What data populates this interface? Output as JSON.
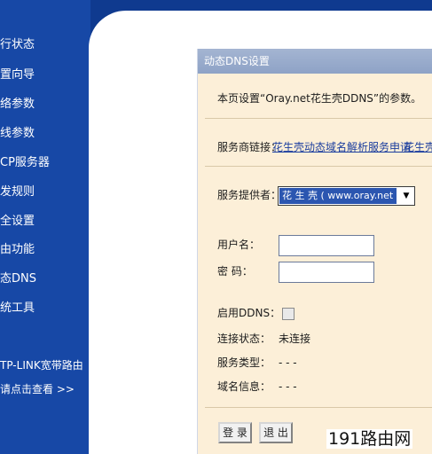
{
  "sidebar": {
    "items": [
      {
        "label": "行状态",
        "name": "sidebar-item-status"
      },
      {
        "label": "置向导",
        "name": "sidebar-item-wizard"
      },
      {
        "label": "络参数",
        "name": "sidebar-item-network"
      },
      {
        "label": "线参数",
        "name": "sidebar-item-wireless"
      },
      {
        "label": "CP服务器",
        "name": "sidebar-item-dhcp"
      },
      {
        "label": "发规则",
        "name": "sidebar-item-forwarding"
      },
      {
        "label": "全设置",
        "name": "sidebar-item-security"
      },
      {
        "label": "由功能",
        "name": "sidebar-item-routing"
      },
      {
        "label": "态DNS",
        "name": "sidebar-item-ddns"
      },
      {
        "label": "统工具",
        "name": "sidebar-item-tools"
      }
    ],
    "note_line1": "TP-LINK宽带路由",
    "note_line2": "请点击查看 >>"
  },
  "panel": {
    "title": "动态DNS设置",
    "intro": "本页设置“Oray.net花生壳DDNS”的参数。",
    "service_link_label": "服务商链接：",
    "service_link_1": "花生壳动态域名解析服务申请",
    "service_link_2": "花生壳动",
    "provider_label": "服务提供者：",
    "provider_value": "花 生 壳 ( www.oray.net )",
    "username_label": "用户名：",
    "username_value": "",
    "password_label": "密  码：",
    "password_value": "",
    "enable_ddns_label": "启用DDNS：",
    "enable_ddns_checked": false,
    "conn_status_label": "连接状态：",
    "conn_status_value": "未连接",
    "service_type_label": "服务类型：",
    "service_type_value": "- - -",
    "domain_info_label": "域名信息：",
    "domain_info_value": "- - -",
    "login_button": "登 录",
    "logout_button": "退 出"
  },
  "watermark": "191路由网",
  "colors": {
    "sidebar": "#1748a6",
    "panel_bg": "#fcefd8",
    "panel_header": "#8ea2c6",
    "link": "#1a3d9e",
    "select_highlight": "#2b56b0"
  }
}
